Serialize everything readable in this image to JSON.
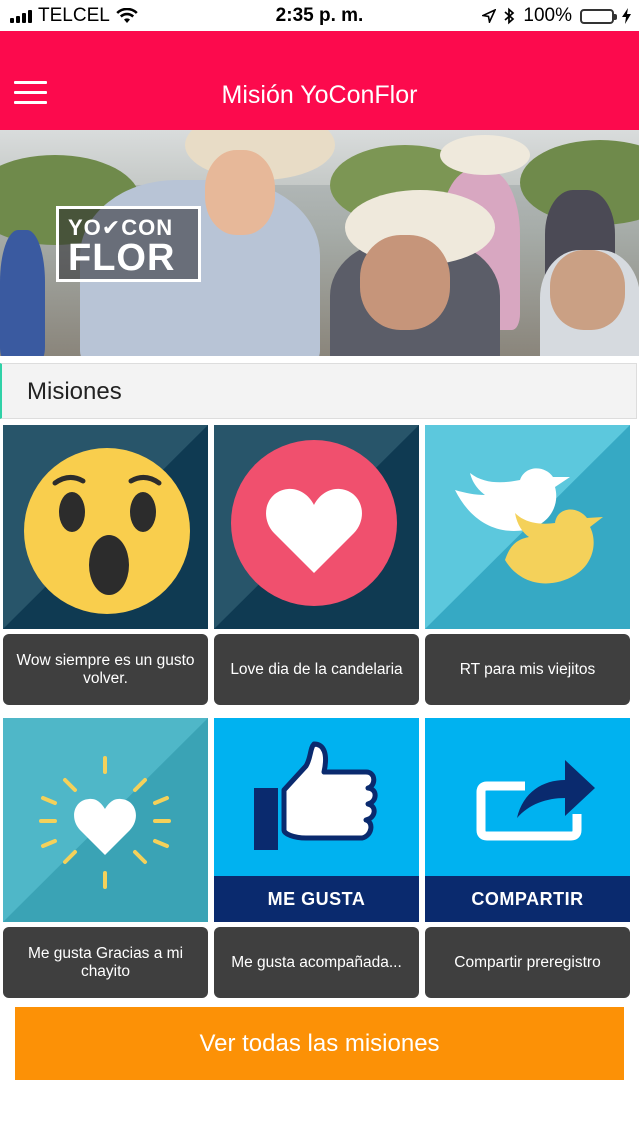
{
  "status_bar": {
    "carrier": "TELCEL",
    "time": "2:35 p. m.",
    "battery": "100%"
  },
  "nav": {
    "title": "Misión YoConFlor",
    "menu_icon": "hamburger-menu-icon"
  },
  "hero": {
    "logo_line1": "YO✔CON",
    "logo_line2": "FLOR"
  },
  "section": {
    "title": "Misiones"
  },
  "missions": [
    {
      "label": "Wow siempre es un gusto volver.",
      "icon": "wow-face-icon"
    },
    {
      "label": "Love dia de la candelaria",
      "icon": "heart-icon"
    },
    {
      "label": "RT para mis viejitos",
      "icon": "retweet-birds-icon"
    },
    {
      "label": "Me gusta Gracias a mi chayito",
      "icon": "glowing-heart-icon"
    },
    {
      "label": "Me gusta acompañada...",
      "icon": "thumbs-up-icon",
      "band": "ME GUSTA"
    },
    {
      "label": "Compartir preregistro",
      "icon": "share-icon",
      "band": "COMPARTIR"
    }
  ],
  "cta": {
    "label": "Ver todas las misiones"
  },
  "colors": {
    "brand": "#fc0a4d",
    "cta": "#fc9106",
    "accent": "#2fd1a7"
  }
}
